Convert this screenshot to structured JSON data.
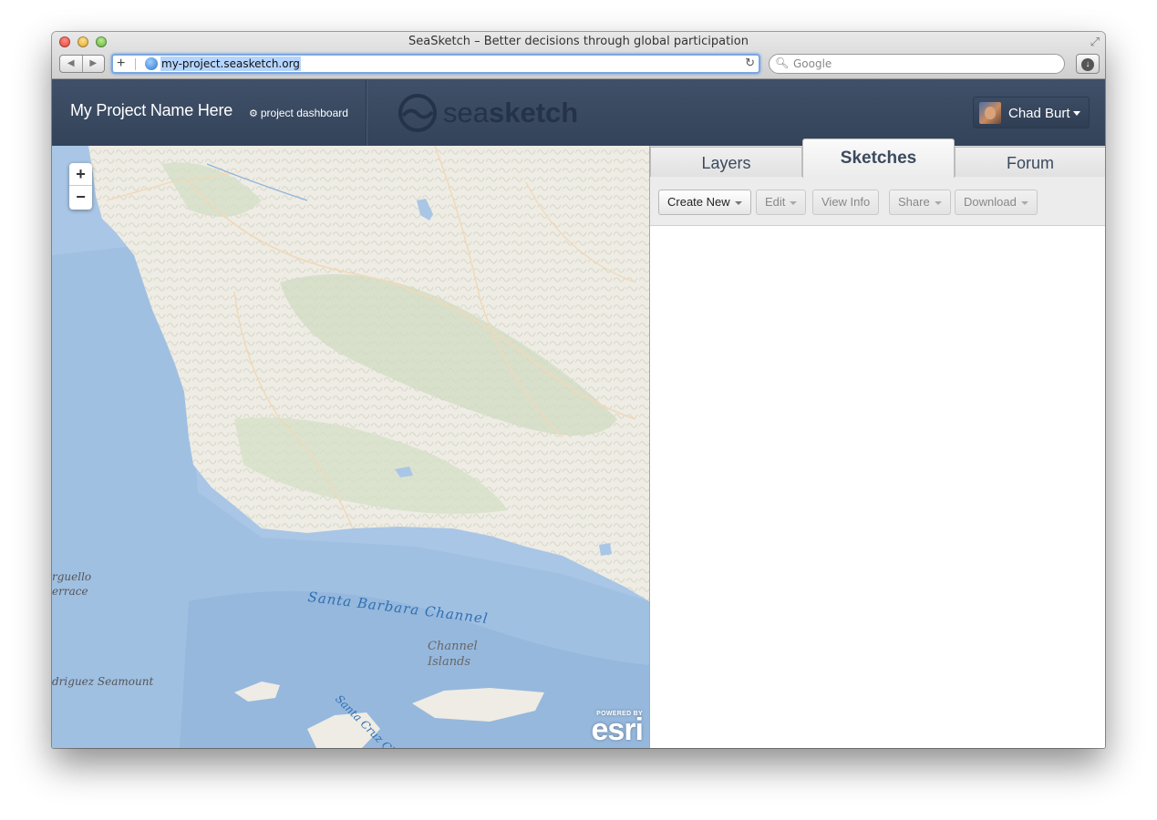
{
  "browser": {
    "title": "SeaSketch – Better decisions through global participation",
    "url": "my-project.seasketch.org",
    "search_placeholder": "Google"
  },
  "header": {
    "project_name": "My Project Name Here",
    "dashboard_link": "project dashboard",
    "logo_text_light": "sea",
    "logo_text_bold": "sketch",
    "user_name": "Chad Burt"
  },
  "map": {
    "labels": {
      "channel": "Santa Barbara Channel",
      "islands_line1": "Channel",
      "islands_line2": "Islands",
      "cruz": "Santa Cruz Channel",
      "arguello1": "rguello",
      "arguello2": "errace",
      "seamount": "driguez Seamount"
    },
    "attribution_small": "POWERED BY",
    "attribution_logo": "esri"
  },
  "panel": {
    "tabs": [
      "Layers",
      "Sketches",
      "Forum"
    ],
    "active_tab": "Sketches",
    "toolbar": {
      "create_new": "Create New",
      "edit": "Edit",
      "view_info": "View Info",
      "share": "Share",
      "download": "Download"
    }
  },
  "colors": {
    "header_bg": "#3a4a62",
    "ocean": "#a9c6e6",
    "land": "#eeece4",
    "label_blue": "#2f6fb2"
  }
}
